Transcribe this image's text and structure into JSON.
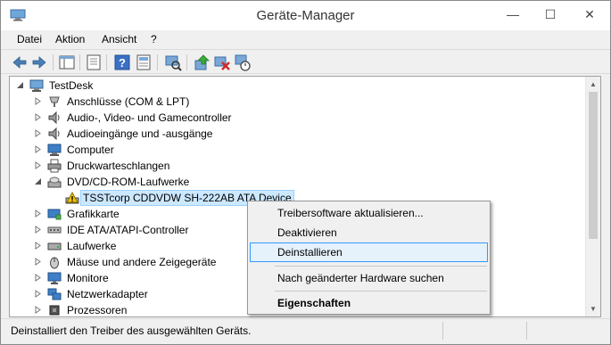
{
  "window": {
    "title": "Geräte-Manager",
    "buttons": {
      "minimize": "—",
      "maximize": "☐",
      "close": "✕"
    }
  },
  "menubar": {
    "items": [
      "Datei",
      "Aktion",
      "Ansicht",
      "?"
    ]
  },
  "toolbar": {
    "buttons": [
      "back-icon",
      "forward-icon",
      "show-hide-console-tree-icon",
      "properties-icon",
      "help-icon",
      "view-icon",
      "scan-hardware-icon",
      "update-driver-icon",
      "uninstall-icon",
      "disable-icon"
    ]
  },
  "tree": {
    "root": "TestDesk",
    "items": [
      {
        "label": "Anschlüsse (COM & LPT)",
        "icon": "port-icon"
      },
      {
        "label": "Audio-, Video- und Gamecontroller",
        "icon": "speaker-icon"
      },
      {
        "label": "Audioeingänge und -ausgänge",
        "icon": "speaker-icon"
      },
      {
        "label": "Computer",
        "icon": "monitor-icon"
      },
      {
        "label": "Druckwarteschlangen",
        "icon": "printer-icon"
      },
      {
        "label": "DVD/CD-ROM-Laufwerke",
        "icon": "disc-drive-icon",
        "expanded": true
      },
      {
        "label": "TSSTcorp CDDVDW SH-222AB ATA Device",
        "icon": "disc-drive-warning-icon",
        "child": true,
        "selected": true
      },
      {
        "label": "Grafikkarte",
        "icon": "display-adapter-icon"
      },
      {
        "label": "IDE ATA/ATAPI-Controller",
        "icon": "ide-controller-icon"
      },
      {
        "label": "Laufwerke",
        "icon": "disk-drive-icon"
      },
      {
        "label": "Mäuse und andere Zeigegeräte",
        "icon": "mouse-icon"
      },
      {
        "label": "Monitore",
        "icon": "monitor-icon"
      },
      {
        "label": "Netzwerkadapter",
        "icon": "network-adapter-icon"
      },
      {
        "label": "Prozessoren",
        "icon": "processor-icon"
      }
    ]
  },
  "context_menu": {
    "update_driver": "Treibersoftware aktualisieren...",
    "disable": "Deaktivieren",
    "uninstall": "Deinstallieren",
    "scan": "Nach geänderter Hardware suchen",
    "properties": "Eigenschaften"
  },
  "statusbar": {
    "text": "Deinstalliert den Treiber des ausgewählten Geräts."
  },
  "colors": {
    "selection_bg": "#cce8ff",
    "highlight_border": "#3399ff",
    "highlight_bg": "#e5f1fb"
  }
}
